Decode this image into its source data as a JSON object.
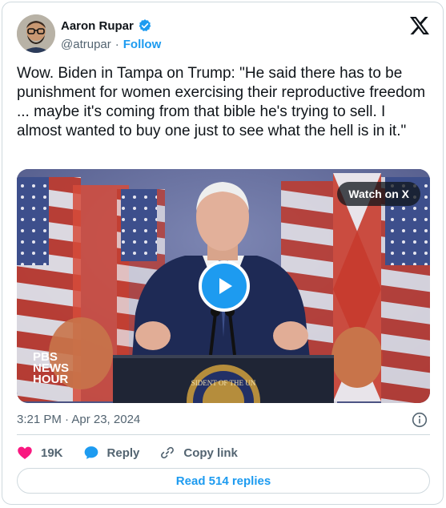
{
  "author": {
    "name": "Aaron Rupar",
    "handle": "@atrupar",
    "separator": "·",
    "follow_label": "Follow"
  },
  "tweet": {
    "text": "Wow. Biden in Tampa on Trump: \"He said there has to be punishment for women exercising their reproductive freedom ... maybe it's coming from that bible he's trying to sell. I almost wanted to buy one just to see what the hell is in it.\"",
    "timestamp": "3:21 PM · Apr 23, 2024"
  },
  "media": {
    "watch_label": "Watch on X",
    "logo_lines": [
      "PBS",
      "NEWS",
      "HOUR"
    ],
    "seal_text": "SIDENT OF THE UN"
  },
  "actions": {
    "likes": "19K",
    "reply_label": "Reply",
    "copy_label": "Copy link"
  },
  "footer": {
    "read_replies_label": "Read 514 replies"
  },
  "colors": {
    "accent": "#1d9bf0",
    "like": "#f91880",
    "text_secondary": "#536471",
    "border": "#cfd9de"
  },
  "icons": [
    "verified-badge-icon",
    "x-logo-icon",
    "play-icon",
    "info-icon",
    "heart-icon",
    "reply-bubble-icon",
    "link-icon"
  ]
}
